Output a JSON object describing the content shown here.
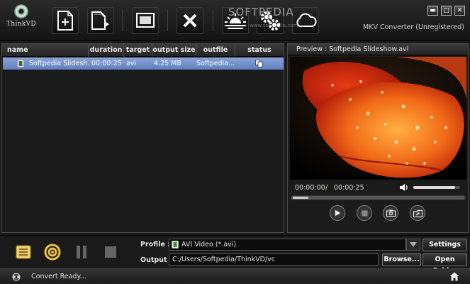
{
  "app": {
    "logo_text": "ThinkVD",
    "title": "MKV Converter (Unregistered)",
    "watermark": "SOFTPEDIA",
    "watermark_url": "www.softpedia.com"
  },
  "window_controls": {
    "minimize": "▬",
    "maximize": "□",
    "close": "✕"
  },
  "toolbar": {
    "buttons": [
      {
        "name": "add-file",
        "icon": "add-file-icon"
      },
      {
        "name": "add-folder",
        "icon": "add-folder-icon"
      },
      {
        "name": "preview-window",
        "icon": "window-icon"
      },
      {
        "name": "remove",
        "icon": "close-icon"
      },
      {
        "name": "effect",
        "icon": "sunrise-icon"
      },
      {
        "name": "settings",
        "icon": "gears-icon"
      },
      {
        "name": "cloud",
        "icon": "cloud-icon"
      }
    ]
  },
  "file_list": {
    "columns": [
      "name",
      "duration",
      "target",
      "output size",
      "outfile",
      "status"
    ],
    "rows": [
      {
        "name": "Softpedia Slidesh...",
        "duration": "00:00:25",
        "target": "avi",
        "output_size": "4.25 MB",
        "outfile": "Softpedia..."
      }
    ]
  },
  "preview": {
    "title": "Preview : Softpedia Slideshow.avi",
    "current_time": "00:00:00",
    "separator": "/",
    "total_time": "00:00:25",
    "volume_fraction": 0.9,
    "seek_fraction": 0.0
  },
  "bottom": {
    "profile_label": "Profile :",
    "profile_value": "AVI Video (*.avi)",
    "output_label": "Output :",
    "output_value": "C:/Users/Softpedia/ThinkVD/vc",
    "settings_button": "Settings >>",
    "browse_button": "Browse...",
    "open_folder_button": "Open Folder"
  },
  "status": {
    "text": "Convert Ready..."
  },
  "colors": {
    "selection": "#6f8cc9",
    "background": "#1a1a1a"
  }
}
